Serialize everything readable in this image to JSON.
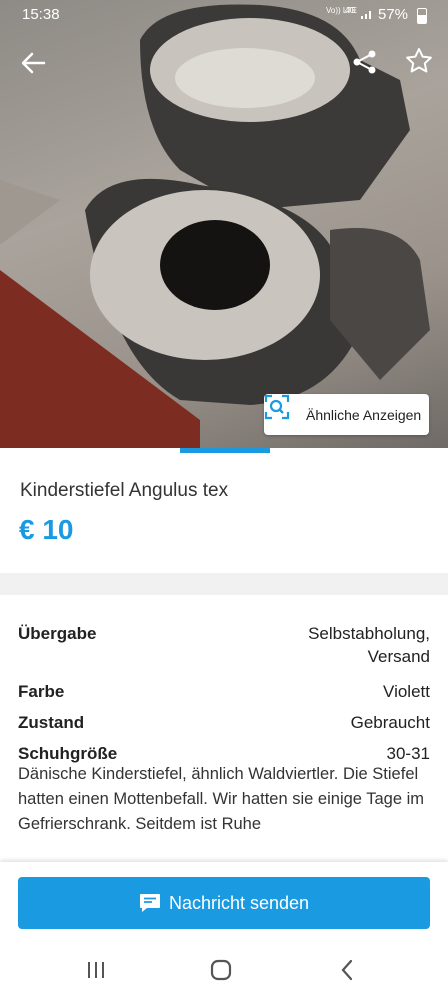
{
  "status": {
    "time": "15:38",
    "net_top": "Vo)) LTE",
    "net_top2": "4G",
    "battery": "57%"
  },
  "listing": {
    "title": "Kinderstiefel Angulus tex",
    "price": "€ 10",
    "similar_label": "Ähnliche Anzeigen"
  },
  "details": [
    {
      "key": "Übergabe",
      "value": "Selbstabholung,\nVersand"
    },
    {
      "key": "Farbe",
      "value": "Violett"
    },
    {
      "key": "Zustand",
      "value": "Gebraucht"
    },
    {
      "key": "Schuhgröße",
      "value": "30-31"
    }
  ],
  "description": "Dänische Kinderstiefel, ähnlich Waldviertler. Die Stiefel hatten einen Mottenbefall. Wir hatten sie einige Tage im Gefrierschrank. Seitdem ist Ruhe",
  "actions": {
    "message_label": "Nachricht senden"
  },
  "colors": {
    "accent": "#1a9ae0",
    "divider": "#f1f1f1"
  },
  "icons": [
    "back-arrow-icon",
    "share-icon",
    "star-icon",
    "image-search-icon",
    "chat-icon",
    "recent-apps-icon",
    "home-icon",
    "back-nav-icon"
  ]
}
